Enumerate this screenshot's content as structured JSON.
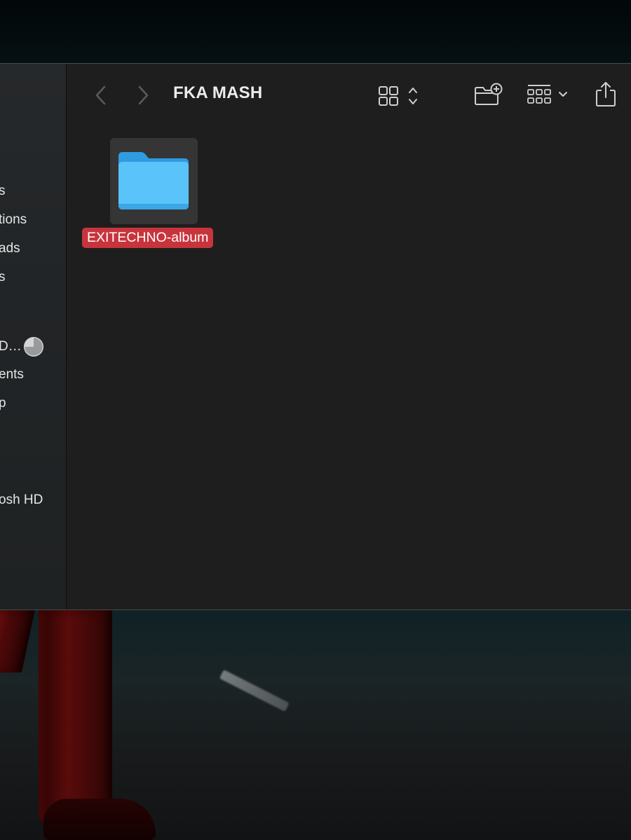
{
  "window": {
    "title": "FKA MASH"
  },
  "sidebar": {
    "items": [
      {
        "label": "s"
      },
      {
        "label": "tions"
      },
      {
        "label": "ads"
      },
      {
        "label": "s"
      },
      {
        "label": "D…"
      },
      {
        "label": "ents"
      },
      {
        "label": "p"
      },
      {
        "label": "osh HD"
      }
    ],
    "disk_icon": "disk-usage-pie-icon"
  },
  "toolbar": {
    "back_icon": "chevron-left-icon",
    "forward_icon": "chevron-right-icon",
    "view_icon": "grid-view-icon",
    "new_folder_icon": "new-folder-icon",
    "group_icon": "group-by-icon",
    "share_icon": "share-icon"
  },
  "files": [
    {
      "name": "EXITECHNO-album",
      "kind": "folder",
      "icon": "folder-icon",
      "selected": true
    }
  ],
  "colors": {
    "window_bg": "#1e1e1e",
    "sidebar_bg": "#24272a",
    "folder_blue": "#4fb8f5",
    "selection_label": "#c8343c",
    "text": "#ececec"
  }
}
